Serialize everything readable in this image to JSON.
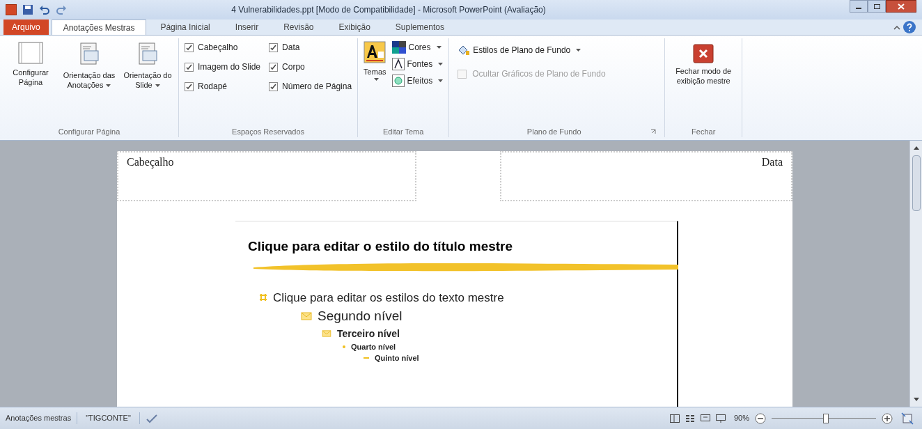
{
  "window": {
    "title": "4 Vulnerabilidades.ppt [Modo de Compatibilidade] - Microsoft PowerPoint (Avaliação)"
  },
  "tabs": [
    {
      "label": "Arquivo",
      "kind": "file",
      "selected": false
    },
    {
      "label": "Anotações Mestras",
      "kind": "tab",
      "selected": true
    },
    {
      "label": "Página Inicial",
      "kind": "tab",
      "selected": false
    },
    {
      "label": "Inserir",
      "kind": "tab",
      "selected": false
    },
    {
      "label": "Revisão",
      "kind": "tab",
      "selected": false
    },
    {
      "label": "Exibição",
      "kind": "tab",
      "selected": false
    },
    {
      "label": "Suplementos",
      "kind": "tab",
      "selected": false
    }
  ],
  "ribbon": {
    "page_setup": {
      "buttons": [
        {
          "label": "Configurar Página",
          "dropdown": false
        },
        {
          "label": "Orientação das Anotações",
          "dropdown": true
        },
        {
          "label": "Orientação do Slide",
          "dropdown": true
        }
      ],
      "group": "Configurar Página"
    },
    "placeholders": {
      "checkboxes": [
        {
          "label": "Cabeçalho",
          "checked": true
        },
        {
          "label": "Data",
          "checked": true
        },
        {
          "label": "Imagem do Slide",
          "checked": true
        },
        {
          "label": "Corpo",
          "checked": true
        },
        {
          "label": "Rodapé",
          "checked": true
        },
        {
          "label": "Número de Página",
          "checked": true
        }
      ],
      "group": "Espaços Reservados"
    },
    "theme": {
      "themes": "Temas",
      "items": [
        "Cores",
        "Fontes",
        "Efeitos"
      ],
      "group": "Editar Tema"
    },
    "background": {
      "styles": "Estilos de Plano de Fundo",
      "hide_graphics": {
        "label": "Ocultar Gráficos de Plano de Fundo",
        "checked": false,
        "disabled": true
      },
      "group": "Plano de Fundo"
    },
    "close": {
      "label": "Fechar modo de exibição mestre",
      "group": "Fechar"
    }
  },
  "page": {
    "header": "Cabeçalho",
    "date": "Data",
    "slide": {
      "title": "Clique para editar o estilo do título mestre",
      "outline": [
        {
          "text": "Clique para editar os estilos do texto mestre",
          "children": [
            {
              "text": "Segundo nível",
              "children": [
                {
                  "text": "Terceiro nível",
                  "children": [
                    {
                      "text": "Quarto nível",
                      "children": [
                        {
                          "text": "Quinto nível"
                        }
                      ]
                    }
                  ]
                }
              ]
            }
          ]
        }
      ]
    }
  },
  "status_bar": {
    "view": "Anotações mestras",
    "theme": "\"TIGCONTE\"",
    "zoom": "90%",
    "zoom_level": {
      "level": 0.52
    }
  }
}
